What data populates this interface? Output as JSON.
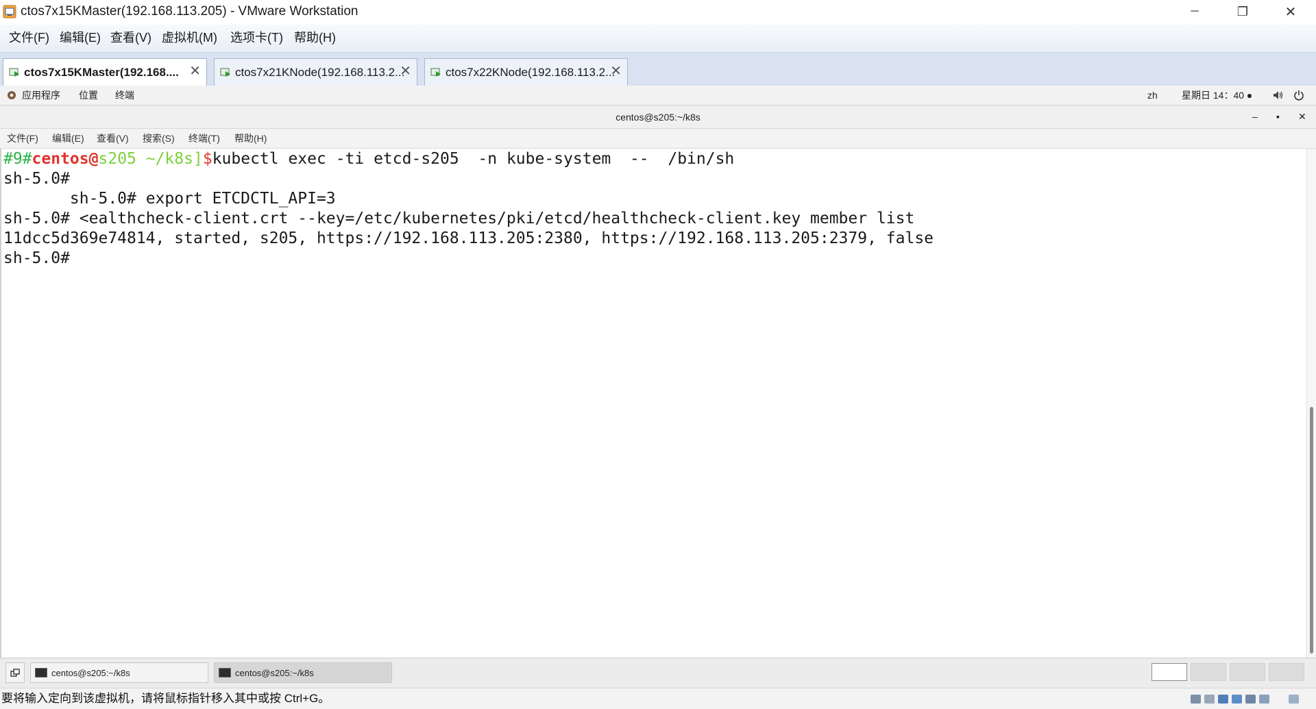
{
  "window": {
    "title": "ctos7x15KMaster(192.168.113.205) - VMware Workstation",
    "controls": {
      "minimize": "─",
      "restore": "❐",
      "close": "✕"
    }
  },
  "menu": [
    "文件(F)",
    "编辑(E)",
    "查看(V)",
    "虚拟机(M)",
    "选项卡(T)",
    "帮助(H)"
  ],
  "tabs": [
    {
      "label": "ctos7x15KMaster(192.168....",
      "close": "✕"
    },
    {
      "label": "ctos7x21KNode(192.168.113.2...",
      "close": "✕"
    },
    {
      "label": "ctos7x22KNode(192.168.113.2...",
      "close": "✕"
    }
  ],
  "gnome_panel": {
    "applications": "应用程序",
    "places": "位置",
    "terminal": "终端",
    "input_method": "zh",
    "clock": "星期日 14：40 ●",
    "volume_icon": "volume-icon",
    "power_icon": "power-icon"
  },
  "terminal": {
    "title": "centos@s205:~/k8s",
    "controls": {
      "minimize": "–",
      "maximize": "▪",
      "close": "✕"
    },
    "menu": [
      "文件(F)",
      "编辑(E)",
      "查看(V)",
      "搜索(S)",
      "终端(T)",
      "帮助(H)"
    ],
    "prompt": {
      "hist": "#9#",
      "user": "centos",
      "at": "@",
      "host": "s205 ~/k8s]",
      "dollar": "$",
      "command": "kubectl exec -ti etcd-s205  -n kube-system  --  /bin/sh"
    },
    "lines": [
      "sh-5.0#",
      "       sh-5.0# export ETCDCTL_API=3",
      "sh-5.0# <ealthcheck-client.crt --key=/etc/kubernetes/pki/etcd/healthcheck-client.key member list",
      "11dcc5d369e74814, started, s205, https://192.168.113.205:2380, https://192.168.113.205:2379, false",
      "sh-5.0#"
    ],
    "colors": {
      "hist": "#2db34a",
      "user": "#e0342c",
      "host": "#7cd13a"
    }
  },
  "taskbar": {
    "items": [
      {
        "label": "centos@s205:~/k8s"
      },
      {
        "label": "centos@s205:~/k8s"
      }
    ]
  },
  "status": {
    "text": "要将输入定向到该虚拟机，请将鼠标指针移入其中或按 Ctrl+G。"
  }
}
